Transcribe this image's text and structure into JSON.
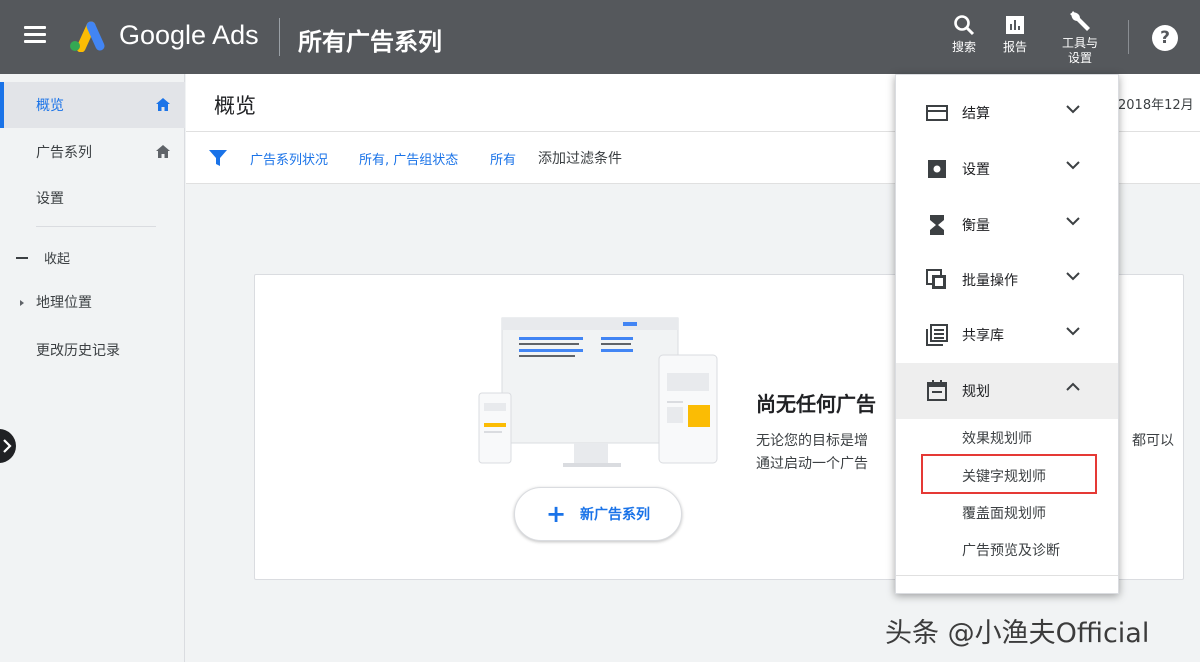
{
  "header": {
    "brand": "Google Ads",
    "page_title": "所有广告系列",
    "search_label": "搜索",
    "reports_label": "报告",
    "tools_label_line1": "工具与",
    "tools_label_line2": "设置",
    "help_label": "?"
  },
  "sidebar": {
    "items": [
      {
        "label": "概览"
      },
      {
        "label": "广告系列"
      },
      {
        "label": "设置"
      }
    ],
    "collapse_label": "收起",
    "geo_label": "地理位置",
    "history_label": "更改历史记录"
  },
  "main": {
    "title": "概览",
    "date_range": "2018年12月"
  },
  "filters": {
    "chip1": "广告系列状况",
    "chip2": "所有, 广告组状态",
    "chip3": "所有",
    "add_label": "添加过滤条件"
  },
  "empty_state": {
    "title": "尚无任何广告",
    "desc_line1_start": "无论您的目标是增",
    "desc_line1_end": "都可以",
    "desc_line2": "通过启动一个广告",
    "button_label": "新广告系列"
  },
  "tools_menu": {
    "sections": [
      {
        "label": "结算",
        "icon": "credit-card-icon",
        "expanded": false
      },
      {
        "label": "设置",
        "icon": "settings-box-icon",
        "expanded": false
      },
      {
        "label": "衡量",
        "icon": "hourglass-icon",
        "expanded": false
      },
      {
        "label": "批量操作",
        "icon": "copy-icon",
        "expanded": false
      },
      {
        "label": "共享库",
        "icon": "library-icon",
        "expanded": false
      },
      {
        "label": "规划",
        "icon": "calendar-icon",
        "expanded": true
      }
    ],
    "planning_items": [
      {
        "label": "效果规划师"
      },
      {
        "label": "关键字规划师"
      },
      {
        "label": "覆盖面规划师"
      },
      {
        "label": "广告预览及诊断"
      }
    ]
  },
  "watermark": "头条 @小渔夫Official",
  "colors": {
    "topbar": "#55585c",
    "accent": "#1a73e8",
    "highlight": "#e53935"
  }
}
